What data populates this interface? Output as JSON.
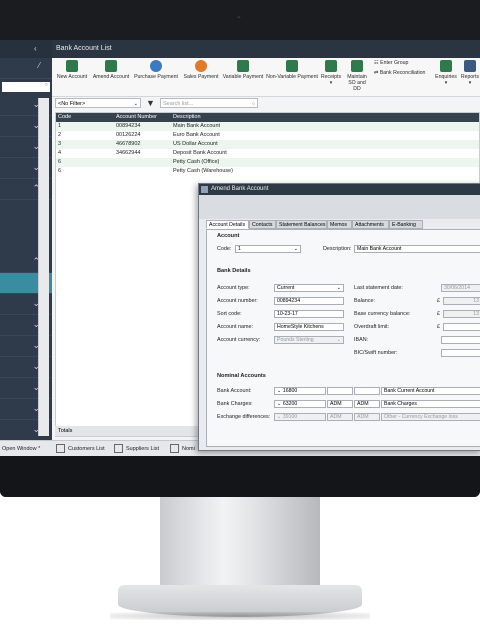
{
  "window": {
    "title": "Bank Account List"
  },
  "toolbar": {
    "buttons": [
      {
        "label": "New Account",
        "color": "#2f7a4a"
      },
      {
        "label": "Amend Account",
        "color": "#2f7a4a"
      },
      {
        "label": "Purchase Payment",
        "color": "#3a7ac0"
      },
      {
        "label": "Sales Payment",
        "color": "#e07a2a"
      },
      {
        "label": "Variable Payment",
        "color": "#2f7a4a"
      },
      {
        "label": "Non-Variable Payment",
        "color": "#2f7a4a"
      },
      {
        "label": "Receipts",
        "color": "#2f7a4a"
      },
      {
        "label": "Maintain SO and DD",
        "color": "#2f7a4a"
      },
      {
        "label": "Enquiries",
        "color": "#2f7a4a"
      },
      {
        "label": "Reports",
        "color": "#3a5a80"
      }
    ],
    "enter_group": "Enter Group",
    "bank_reconciliation": "Bank Reconciliation"
  },
  "filter": {
    "value": "<No Filter>",
    "search_placeholder": "Search list..."
  },
  "grid": {
    "headers": [
      "Code",
      "Account Number",
      "Description"
    ],
    "rows": [
      [
        "1",
        "00894234",
        "Main Bank Account"
      ],
      [
        "2",
        "00126224",
        "Euro Bank Account"
      ],
      [
        "3",
        "46678902",
        "US Dollar Account"
      ],
      [
        "4",
        "34662944",
        "Deposit Bank Account"
      ],
      [
        "6",
        "",
        "Petty Cash (Office)"
      ],
      [
        "6",
        "",
        "Petty Cash (Warehouse)"
      ]
    ],
    "totals_label": "Totals"
  },
  "taskbar": [
    "Open Window *",
    "Customers List",
    "Suppliers List",
    "Nomi"
  ],
  "dialog": {
    "title": "Amend Bank Account",
    "tabs": [
      "Account Details",
      "Contacts",
      "Statement Balances",
      "Memos",
      "Attachments",
      "E-Banking"
    ],
    "account": {
      "section": "Account",
      "code_label": "Code:",
      "code": "1",
      "desc_label": "Description:",
      "desc": "Main Bank Account"
    },
    "bank_details": {
      "section": "Bank Details",
      "type_label": "Account type:",
      "type": "Current",
      "number_label": "Account number:",
      "number": "00894234",
      "sort_label": "Sort code:",
      "sort": "10-23-17",
      "name_label": "Account name:",
      "name": "HomeStyle Kitchens",
      "currency_label": "Account currency:",
      "currency": "Pounds Sterling",
      "last_statement_label": "Last statement date:",
      "last_statement": "30/06/2014",
      "balance_label": "Balance:",
      "balance_sym": "£",
      "balance": "13",
      "base_balance_label": "Base currency balance:",
      "base_balance_sym": "£",
      "base_balance": "13",
      "overdraft_label": "Overdraft limit:",
      "overdraft_sym": "£",
      "iban_label": "IBAN:",
      "bic_label": "BIC/Swift number:"
    },
    "nominal": {
      "section": "Nominal Accounts",
      "bank_label": "Bank Account:",
      "bank_code": "16800",
      "bank_name": "Bank Current Account",
      "charges_label": "Bank Charges:",
      "charges_code": "63200",
      "charges_cc": "ADM",
      "charges_dept": "ADM",
      "charges_name": "Bank Charges",
      "exch_label": "Exchange differences:",
      "exch_code": "39100",
      "exch_cc": "ADM",
      "exch_dept": "ADM",
      "exch_name": "Other - Currency Exchange loss"
    }
  }
}
